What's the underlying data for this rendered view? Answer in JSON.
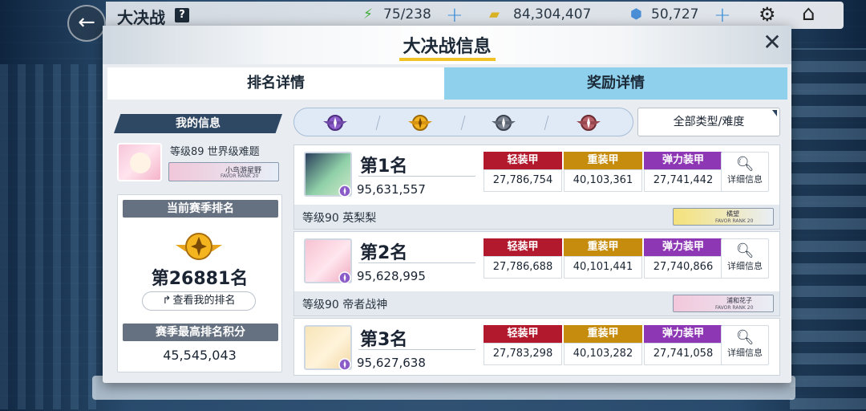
{
  "topbar": {
    "title": "大决战",
    "help": "?",
    "energy": "75/238",
    "credits": "84,304,407",
    "gems": "50,727"
  },
  "modal": {
    "title": "大决战信息",
    "tabs": {
      "ranking": "排名详情",
      "rewards": "奖励详情"
    }
  },
  "my_info": {
    "header": "我的信息",
    "level": "等级89 世界级难题",
    "favor_name": "小鸟游星野",
    "favor_rank": "FAVOR RANK 20",
    "current_rank_label": "当前赛季排名",
    "current_rank": "第26881名",
    "view_rank_button": "查看我的排名",
    "best_score_label": "赛季最高排名积分",
    "best_score": "45,545,043"
  },
  "filter": {
    "type_select": "全部类型/难度"
  },
  "armor_labels": {
    "light": "轻装甲",
    "heavy": "重装甲",
    "elastic": "弹力装甲"
  },
  "detail_label": "详细信息",
  "ranking": [
    {
      "rank": "第1名",
      "score": "95,631,557",
      "light": "27,786,754",
      "heavy": "40,103,361",
      "elastic": "27,741,442",
      "level": "等级90  英梨梨",
      "favor_name": "橘望",
      "favor_rank": "FAVOR RANK 20"
    },
    {
      "rank": "第2名",
      "score": "95,628,995",
      "light": "27,786,688",
      "heavy": "40,101,441",
      "elastic": "27,740,866",
      "level": "等级90  帝者战神",
      "favor_name": "浦和花子",
      "favor_rank": "FAVOR RANK 20"
    },
    {
      "rank": "第3名",
      "score": "95,627,638",
      "light": "27,783,298",
      "heavy": "40,103,282",
      "elastic": "27,741,058"
    }
  ]
}
